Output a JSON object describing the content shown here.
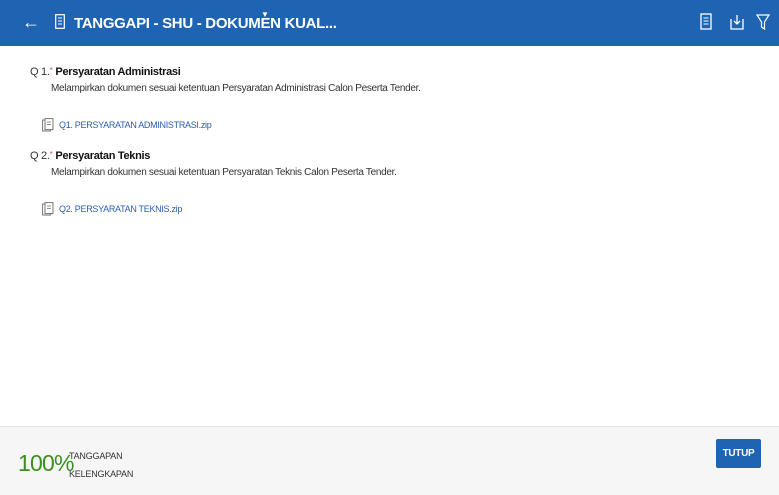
{
  "header": {
    "back_icon": "arrow-left-icon",
    "title": "TANGGAPI - SHU - DOKUMEN KUAL...",
    "title_icon": "document-icon",
    "dropdown_icon": "caret-down-icon",
    "actions": [
      "document-icon",
      "download-icon",
      "filter-icon"
    ],
    "bg_color": "#1f63b3"
  },
  "questions": [
    {
      "number": "Q 1.",
      "required_mark": "*",
      "title": "Persyaratan Administrasi",
      "description": "Melampirkan dokumen sesuai ketentuan Persyaratan Administrasi Calon Peserta Tender.",
      "file": "Q1. PERSYARATAN ADMINISTRASI.zip"
    },
    {
      "number": "Q 2.",
      "required_mark": "*",
      "title": "Persyaratan Teknis",
      "description": "Melampirkan dokumen sesuai ketentuan Persyaratan Teknis Calon Peserta Tender.",
      "file": "Q2. PERSYARATAN TEKNIS.zip"
    }
  ],
  "footer": {
    "percent": "100%",
    "label_line1": "TANGGAPAN",
    "label_line2": "KELENGKAPAN",
    "close_button": "TUTUP",
    "percent_color": "#3b8e1f"
  }
}
